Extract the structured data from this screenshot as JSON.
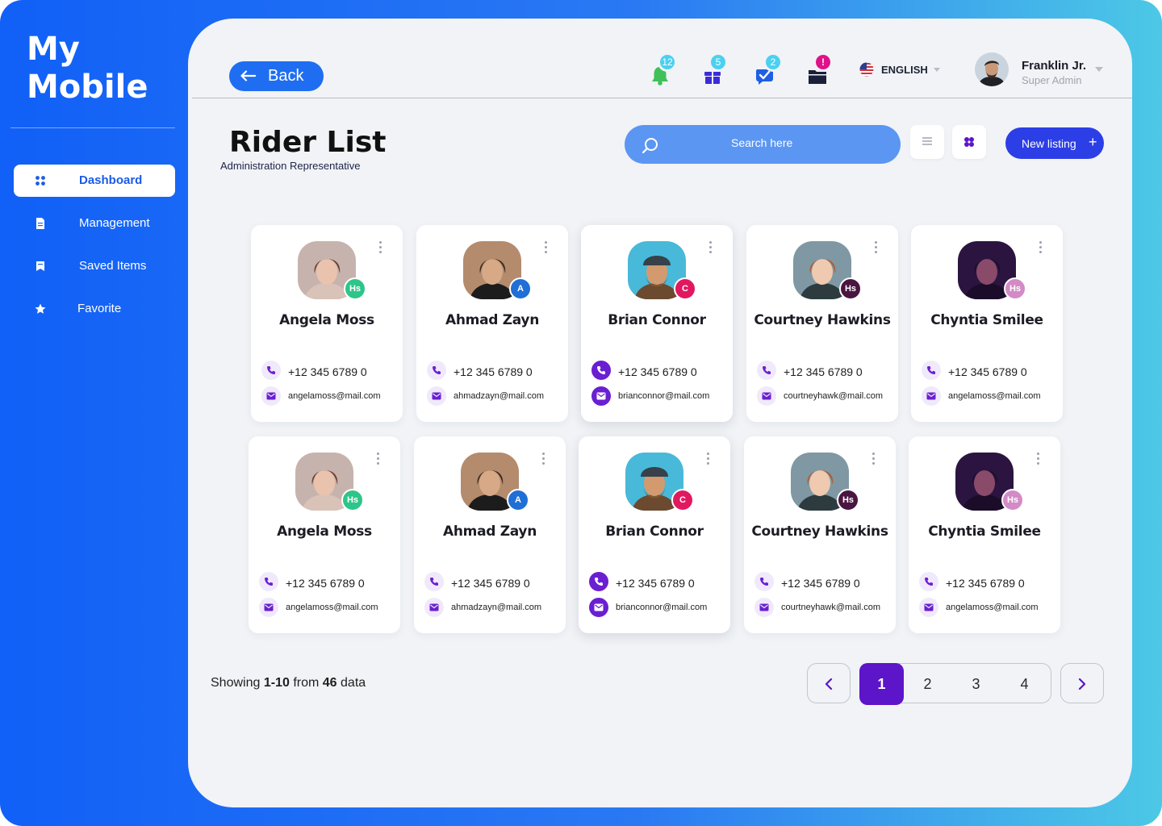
{
  "brand": {
    "line1": "My",
    "line2": "Mobile"
  },
  "sidebar": {
    "items": [
      {
        "label": "Dashboard",
        "icon": "dashboard-icon",
        "active": true
      },
      {
        "label": "Management",
        "icon": "document-icon"
      },
      {
        "label": "Saved Items",
        "icon": "bookmark-icon"
      },
      {
        "label": "Favorite",
        "icon": "star-icon"
      }
    ]
  },
  "header": {
    "back_label": "Back",
    "notifications": [
      {
        "icon": "bell-icon",
        "count": "12",
        "color": "#4bd0f0"
      },
      {
        "icon": "gift-icon",
        "count": "5",
        "color": "#4bd0f0"
      },
      {
        "icon": "message-check-icon",
        "count": "2",
        "color": "#4bd0f0"
      },
      {
        "icon": "folder-icon",
        "count": "!",
        "color": "#e0128a"
      }
    ],
    "language": "ENGLISH",
    "user": {
      "name": "Franklin Jr.",
      "role": "Super Admin"
    }
  },
  "page": {
    "title": "Rider List",
    "subtitle": "Administration Representative",
    "search_placeholder": "Search here",
    "new_listing_label": "New listing",
    "new_listing_plus": "+"
  },
  "riders": [
    {
      "name": "Angela Moss",
      "phone": "+12 345 6789 0",
      "email": "angelamoss@mail.com",
      "tag": "Hs",
      "tag_color": "#2ec58a"
    },
    {
      "name": "Ahmad Zayn",
      "phone": "+12 345 6789 0",
      "email": "ahmadzayn@mail.com",
      "tag": "A",
      "tag_color": "#1f6fd6"
    },
    {
      "name": "Brian Connor",
      "phone": "+12 345 6789 0",
      "email": "brianconnor@mail.com",
      "tag": "C",
      "tag_color": "#e1185f",
      "highlighted": true
    },
    {
      "name": "Courtney Hawkins",
      "phone": "+12 345 6789 0",
      "email": "courtneyhawk@mail.com",
      "tag": "Hs",
      "tag_color": "#4a1540"
    },
    {
      "name": "Chyntia Smilee",
      "phone": "+12 345 6789 0",
      "email": "angelamoss@mail.com",
      "tag": "Hs",
      "tag_color": "#d28bc6"
    },
    {
      "name": "Angela Moss",
      "phone": "+12 345 6789 0",
      "email": "angelamoss@mail.com",
      "tag": "Hs",
      "tag_color": "#2ec58a"
    },
    {
      "name": "Ahmad Zayn",
      "phone": "+12 345 6789 0",
      "email": "ahmadzayn@mail.com",
      "tag": "A",
      "tag_color": "#1f6fd6"
    },
    {
      "name": "Brian Connor",
      "phone": "+12 345 6789 0",
      "email": "brianconnor@mail.com",
      "tag": "C",
      "tag_color": "#e1185f",
      "highlighted": true
    },
    {
      "name": "Courtney Hawkins",
      "phone": "+12 345 6789 0",
      "email": "courtneyhawk@mail.com",
      "tag": "Hs",
      "tag_color": "#4a1540"
    },
    {
      "name": "Chyntia Smilee",
      "phone": "+12 345 6789 0",
      "email": "angelamoss@mail.com",
      "tag": "Hs",
      "tag_color": "#d28bc6"
    }
  ],
  "pagination": {
    "showing_prefix": "Showing",
    "range": "1-10",
    "from_word": "from",
    "total": "46",
    "data_word": "data",
    "pages": [
      "1",
      "2",
      "3",
      "4"
    ],
    "current": "1"
  }
}
